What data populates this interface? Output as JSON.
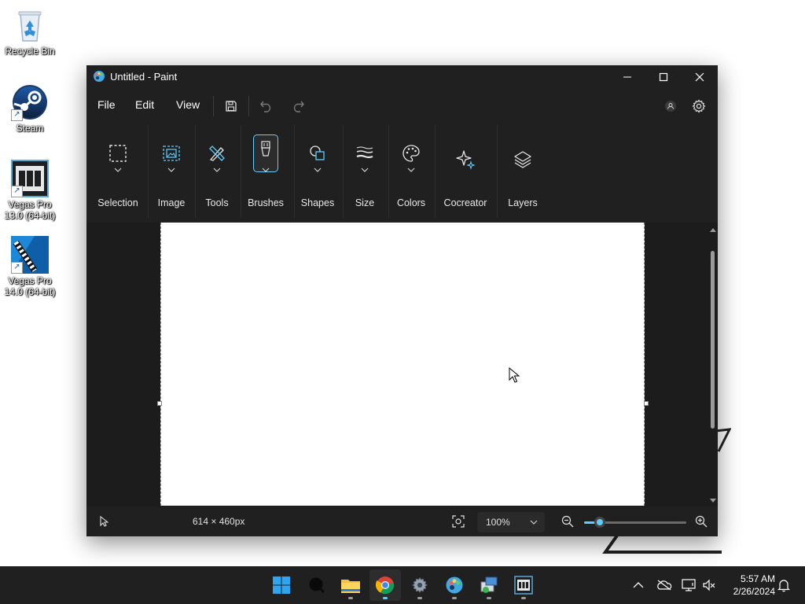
{
  "desktop": {
    "icons": [
      {
        "label": "Recycle Bin",
        "icon": "recycle-bin-icon"
      },
      {
        "label": "Steam",
        "icon": "steam-icon"
      },
      {
        "label": "Vegas Pro 13.0 (64-bit)",
        "icon": "vegas-pro-13-icon"
      },
      {
        "label": "Vegas Pro 14.0 (64-bit)",
        "icon": "vegas-pro-14-icon"
      }
    ]
  },
  "window": {
    "title": "Untitled - Paint",
    "controls": {
      "minimize": "minimize-icon",
      "maximize": "maximize-icon",
      "close": "close-icon"
    }
  },
  "menubar": {
    "items": [
      "File",
      "Edit",
      "View"
    ],
    "icons": [
      "save-icon",
      "undo-icon",
      "redo-icon",
      "account-icon",
      "settings-icon"
    ]
  },
  "ribbon": {
    "groups": [
      {
        "label": "Selection",
        "icon": "selection-icon"
      },
      {
        "label": "Image",
        "icon": "image-icon"
      },
      {
        "label": "Tools",
        "icon": "tools-icon"
      },
      {
        "label": "Brushes",
        "icon": "brush-icon",
        "selected": true
      },
      {
        "label": "Shapes",
        "icon": "shapes-icon"
      },
      {
        "label": "Size",
        "icon": "size-icon"
      },
      {
        "label": "Colors",
        "icon": "palette-icon"
      },
      {
        "label": "Cocreator",
        "icon": "cocreator-icon"
      },
      {
        "label": "Layers",
        "icon": "layers-icon"
      }
    ]
  },
  "canvas": {
    "color": "#ffffff"
  },
  "statusbar": {
    "canvas_size": "614 × 460px",
    "zoom": "100%",
    "zoom_level_fraction": 0.15
  },
  "taskbar": {
    "apps": [
      "start-icon",
      "search-icon",
      "file-explorer-icon",
      "chrome-icon",
      "settings-icon",
      "paint-icon",
      "app-icon",
      "vegas-icon"
    ],
    "time": "5:57 AM",
    "date": "2/26/2024"
  },
  "colors": {
    "accent": "#60cdff",
    "window_bg": "#202020",
    "canvas_bg": "#1c1c1c"
  }
}
